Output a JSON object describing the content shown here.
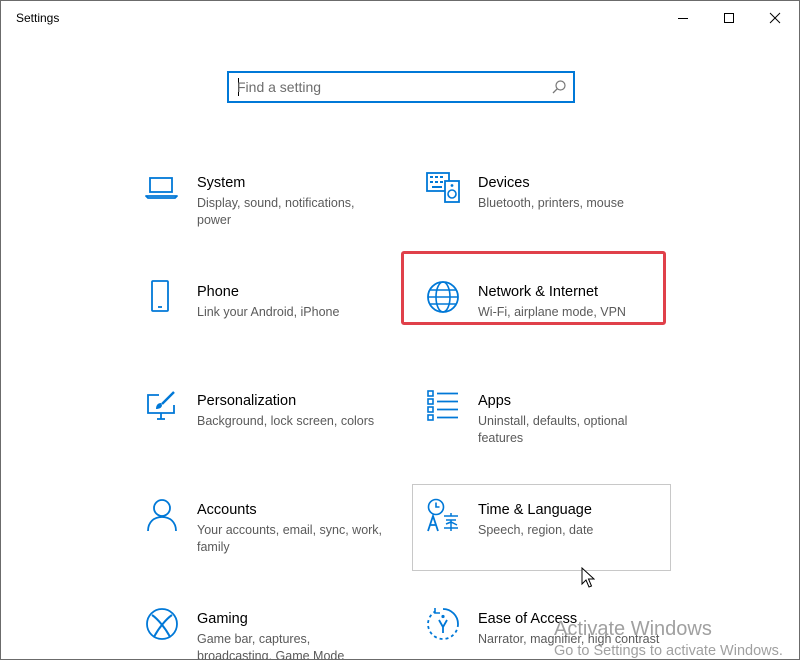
{
  "window": {
    "title": "Settings",
    "controls": [
      "minimize",
      "maximize",
      "close"
    ]
  },
  "search": {
    "placeholder": "Find a setting",
    "icon": "search-icon"
  },
  "accent_color": "#0078d7",
  "highlight_color": "#e0404a",
  "categories": [
    {
      "id": "system",
      "name": "System",
      "description": "Display, sound, notifications, power",
      "icon": "laptop-icon"
    },
    {
      "id": "devices",
      "name": "Devices",
      "description": "Bluetooth, printers, mouse",
      "icon": "keyboard-speaker-icon"
    },
    {
      "id": "phone",
      "name": "Phone",
      "description": "Link your Android, iPhone",
      "icon": "phone-icon"
    },
    {
      "id": "network",
      "name": "Network & Internet",
      "description": "Wi-Fi, airplane mode, VPN",
      "icon": "globe-icon"
    },
    {
      "id": "personalization",
      "name": "Personalization",
      "description": "Background, lock screen, colors",
      "icon": "paintbrush-monitor-icon"
    },
    {
      "id": "apps",
      "name": "Apps",
      "description": "Uninstall, defaults, optional features",
      "icon": "list-icon"
    },
    {
      "id": "accounts",
      "name": "Accounts",
      "description": "Your accounts, email, sync, work, family",
      "icon": "person-icon"
    },
    {
      "id": "time-language",
      "name": "Time & Language",
      "description": "Speech, region, date",
      "icon": "time-language-icon"
    },
    {
      "id": "gaming",
      "name": "Gaming",
      "description": "Game bar, captures, broadcasting, Game Mode",
      "icon": "xbox-icon"
    },
    {
      "id": "ease-of-access",
      "name": "Ease of Access",
      "description": "Narrator, magnifier, high contrast",
      "icon": "ease-of-access-icon"
    }
  ],
  "watermark": {
    "line1": "Activate Windows",
    "line2": "Go to Settings to activate Windows."
  }
}
